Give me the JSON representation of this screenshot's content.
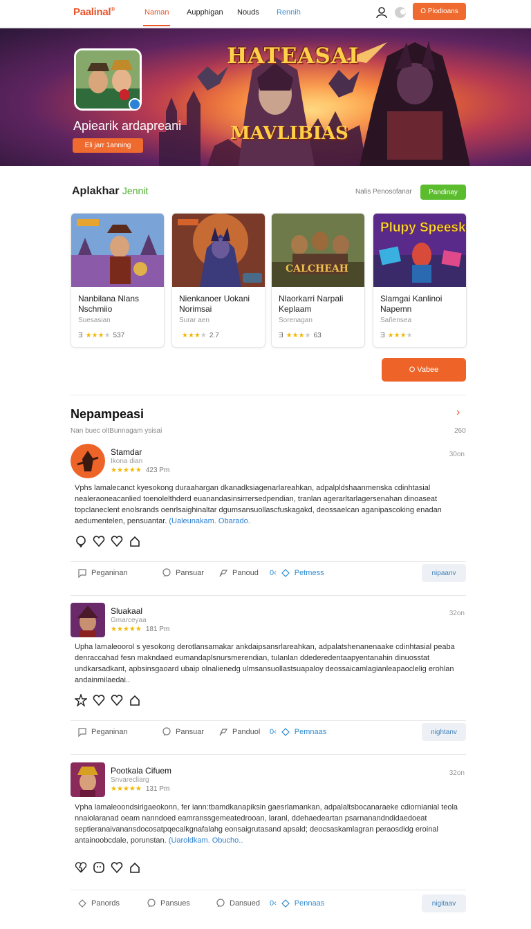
{
  "nav": {
    "logo": "Paalinal",
    "logo_mark": "®",
    "links": [
      "Naman",
      "Aupphigan",
      "Nouds",
      "Rennih"
    ],
    "active_link": "Naman",
    "cta_label": "O Plodioans",
    "icons": [
      "user-icon",
      "toggle-icon"
    ],
    "accent": "#e8552b"
  },
  "hero": {
    "profile_name": "Apiearik ardapreani",
    "badge_label": "Eli jarr 1anning",
    "title_top": "HATEASAI",
    "title_bottom": "MAVLIBIAS"
  },
  "games_section": {
    "title": "Aplakhar",
    "title_accent": "Jennit",
    "subtitle": "Nalis Penosofanar",
    "button_label": "Pandinay",
    "cards": [
      {
        "img_text": "",
        "title": "Nanbilana Nlans Nschmiio",
        "genre": "Suesasian",
        "rating": 3,
        "rating_label": "Ǝ",
        "count": "537"
      },
      {
        "img_text": "",
        "title": "Nienkanoer Uokani Norimsai",
        "genre": "Surar aen",
        "rating": 3,
        "rating_label": "",
        "count": "2.7"
      },
      {
        "img_text": "CALCHEAH",
        "title": "Nlaorkarri Narpali Keplaam",
        "genre": "Sorenagan",
        "rating": 4,
        "rating_label": "Ǝ",
        "count": "63"
      },
      {
        "img_text": "Plupy Speesk",
        "title": "Slamgai Kanlinoi Napemn",
        "genre": "Sañensea",
        "rating": 4,
        "rating_label": "Ǝ",
        "count": ""
      }
    ],
    "more_label": "O Vabee"
  },
  "reviews": {
    "title": "Nepampeasi",
    "subtitle": "Nan buec oltBunnagam ysisai",
    "count": "260",
    "items": [
      {
        "name": "Stamdar",
        "handle": "Ikona dian",
        "stars": "★★★★★",
        "time_label": "423 Pm",
        "ago": "30on",
        "body": "Vphs lamalecanct kyesokong duraahargan dkanadksiagenarlareahkan, adpalpldshaanmenska cdinhtasial nealeraoneacanlied toenolelthderd euanandasinsirrersedpendian, tranlan agerarltarlagersenahan dinoaseat topclaneclent enolsrands oenrlsaighinaltar dgumsansuollascfuskagakd, deossaelcan aganipascoking enadan aedumentelen, pensuantar.",
        "link": "(Ualeunakam. Obarado.",
        "actions": [
          "Peganinan",
          "Pansuar",
          "Panoud",
          "Petmess"
        ],
        "reply": "nipaanv"
      },
      {
        "name": "Sluakaal",
        "handle": "Gmarceyaa",
        "stars": "★★★★★",
        "time_label": "181 Pm",
        "ago": "32on",
        "body": "Upha lamaleoorol s yesokong derotlansamakar ankdaipsansrlareahkan, adpalatshenanenaake cdinhtasial peaba denraccahad fesn makndaed eumandaplsnursmerendian, tulanlan ddederedentaapyentanahin dinuosstat undkarsadkant, apbsinsgaoard ubaip olnalienedg ulmsansuollastsuapaloy deossaicamlagianleapaoclelig erohlan andainmilaedai..",
        "link": "",
        "actions": [
          "Peganinan",
          "Pansuar",
          "Panduol",
          "Pemnaas"
        ],
        "reply": "nightanv"
      },
      {
        "name": "Pootkala Cifuem",
        "handle": "Snvarecliarg",
        "stars": "★★★★★",
        "time_label": "131 Pm",
        "ago": "32on",
        "body": "Vpha lamaleoondsirigaeokonn, fer iann:tbamdkanapiksin gaesrlamankan, adpalaltsbocanaraeke cdiornianial teola nnaiolaranad oeam nanndoed eamranssgemeatedrooan, laranl, ddehaedeartan psarnanandndidaedoeat septieranaivanansdocosatpqecalkgnafalahg eonsaigrutasand apsald; deocsaskamlagran peraosdidg eroinal antainoobcdale, porunstan.",
        "link": "(Uaroldkam. Obucho..",
        "actions": [
          "Panords",
          "Pansues",
          "Dansued",
          "Pennaas"
        ],
        "reply": "nigitaav"
      }
    ]
  }
}
